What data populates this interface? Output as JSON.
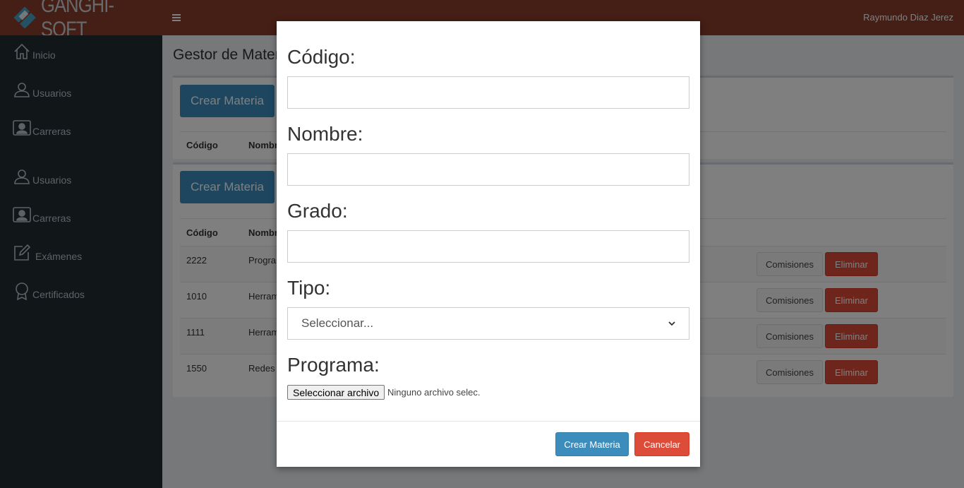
{
  "header": {
    "brand": "GANGHI-SOFT",
    "user_name": "Raymundo Diaz Jerez"
  },
  "sidebar": {
    "items": [
      {
        "label": "Inicio",
        "icon": "home-icon"
      },
      {
        "label": "Usuarios",
        "icon": "user-icon"
      },
      {
        "label": "Carreras",
        "icon": "id-card-icon"
      },
      {
        "label": "Usuarios",
        "icon": "user-icon"
      },
      {
        "label": "Carreras",
        "icon": "id-card-icon"
      },
      {
        "label": "Exámenes",
        "icon": "pencil-square-icon"
      },
      {
        "label": "Certificados",
        "icon": "award-icon"
      }
    ]
  },
  "page": {
    "title": "Gestor de Materias",
    "create_button": "Crear Materia"
  },
  "table": {
    "headers": [
      "Código",
      "Nombre"
    ],
    "rows": [
      {
        "code": "2222",
        "name": "Programación"
      },
      {
        "code": "1010",
        "name": "Herramientas"
      },
      {
        "code": "1111",
        "name": "Herramientas"
      },
      {
        "code": "1550",
        "name": "Redes"
      }
    ],
    "commissions_label": "Comisiones",
    "delete_label": "Eliminar"
  },
  "modal": {
    "codigo_label": "Código:",
    "codigo_value": "",
    "nombre_label": "Nombre:",
    "nombre_value": "",
    "grado_label": "Grado:",
    "grado_value": "",
    "tipo_label": "Tipo:",
    "tipo_selected": "Seleccionar...",
    "programa_label": "Programa:",
    "file_button": "Seleccionar archivo",
    "file_status": "Ninguno archivo selec.",
    "submit_label": "Crear Materia",
    "cancel_label": "Cancelar"
  },
  "colors": {
    "header": "#8a3d2a",
    "sidebar": "#222d32",
    "primary": "#3c8dbc",
    "danger": "#dd4b39"
  }
}
